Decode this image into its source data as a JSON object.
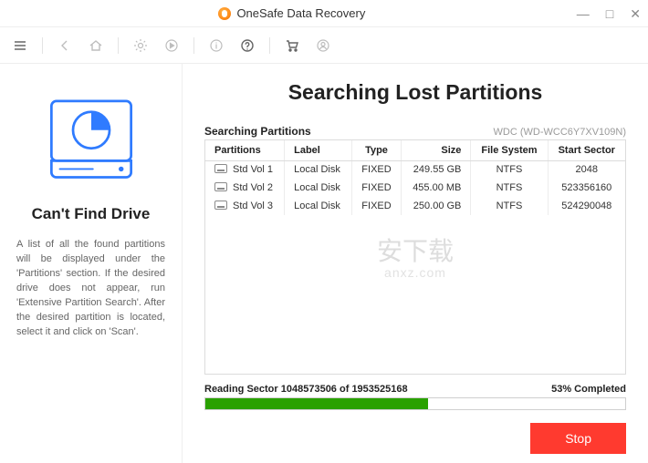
{
  "app": {
    "title": "OneSafe Data Recovery"
  },
  "window": {
    "min": "—",
    "max": "□",
    "close": "✕"
  },
  "toolbar": {
    "menu": "menu",
    "back": "back",
    "home": "home",
    "sep1": "|",
    "gear": "settings",
    "play": "play",
    "sep2": "|",
    "info": "info",
    "help": "help",
    "sep3": "|",
    "cart": "cart",
    "user": "user"
  },
  "side": {
    "heading": "Can't Find Drive",
    "desc": "A list of all the found partitions will be displayed under the 'Partitions' section. If the desired drive does not appear, run 'Extensive Partition Search'. After the desired partition is located, select it and click on 'Scan'."
  },
  "content": {
    "title": "Searching Lost Partitions",
    "subtitle": "Searching Partitions",
    "diskId": "WDC (WD-WCC6Y7XV109N)",
    "columns": {
      "partitions": "Partitions",
      "label": "Label",
      "type": "Type",
      "size": "Size",
      "fs": "File System",
      "start": "Start Sector"
    },
    "rows": [
      {
        "name": "Std Vol 1",
        "label": "Local Disk",
        "type": "FIXED",
        "size": "249.55 GB",
        "fs": "NTFS",
        "start": "2048"
      },
      {
        "name": "Std Vol 2",
        "label": "Local Disk",
        "type": "FIXED",
        "size": "455.00 MB",
        "fs": "NTFS",
        "start": "523356160"
      },
      {
        "name": "Std Vol 3",
        "label": "Local Disk",
        "type": "FIXED",
        "size": "250.00 GB",
        "fs": "NTFS",
        "start": "524290048"
      }
    ],
    "watermark": {
      "zh": "安下载",
      "domain": "anxz.com"
    }
  },
  "progress": {
    "label_prefix": "Reading Sector ",
    "current": "1048573506",
    "sep": " of ",
    "total": "1953525168",
    "percent_text": "53% Completed",
    "percent_css": "53%"
  },
  "footer": {
    "stop": "Stop"
  }
}
